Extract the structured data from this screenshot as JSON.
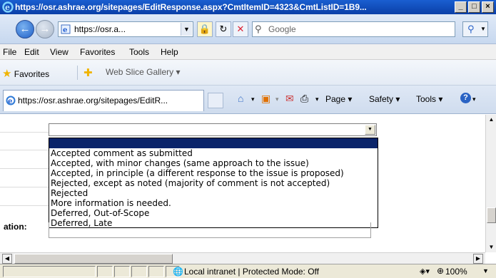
{
  "window": {
    "title": "https://osr.ashrae.org/sitepages/EditResponse.aspx?CmtItemID=4323&CmtListID=1B9...",
    "buttons": [
      "_",
      "□",
      "×"
    ]
  },
  "address_bar": {
    "url": "https://osr.a...",
    "search_placeholder": "Google"
  },
  "menu": [
    "File",
    "Edit",
    "View",
    "Favorites",
    "Tools",
    "Help"
  ],
  "favorites_bar": {
    "favorites_label": "Favorites",
    "web_slice_label": "Web Slice Gallery ▾"
  },
  "tab": {
    "title": "https://osr.ashrae.org/sitepages/EditR..."
  },
  "command_bar": {
    "page": "Page ▾",
    "safety": "Safety ▾",
    "tools": "Tools ▾"
  },
  "form": {
    "combo_value": "",
    "options": [
      "",
      "Accepted comment as submitted",
      "Accepted, with minor changes (same approach to the issue)",
      "Accepted, in principle (a different response to the issue is proposed)",
      "Rejected, except as noted (majority of comment is not accepted)",
      "Rejected",
      "More information is needed.",
      "Deferred, Out-of-Scope",
      "Deferred, Late"
    ],
    "selected_index": 0,
    "truncated_label": "ation:"
  },
  "status_bar": {
    "zone": "Local intranet | Protected Mode: Off",
    "zoom": "100%"
  },
  "colors": {
    "title_bar": "#0a3fa8",
    "selection": "#0a246a"
  }
}
